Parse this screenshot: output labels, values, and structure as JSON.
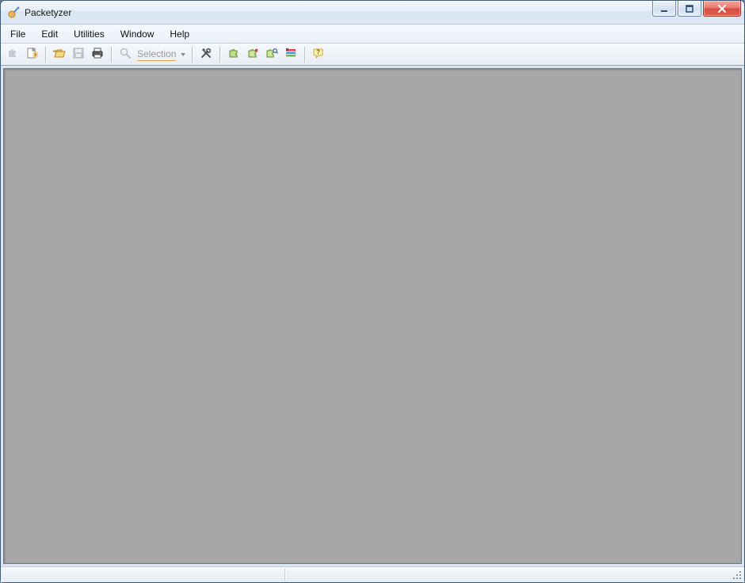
{
  "window": {
    "title": "Packetyzer"
  },
  "menu": {
    "file": "File",
    "edit": "Edit",
    "utilities": "Utilities",
    "window": "Window",
    "help": "Help"
  },
  "toolbar": {
    "selection_label": "Selection"
  }
}
